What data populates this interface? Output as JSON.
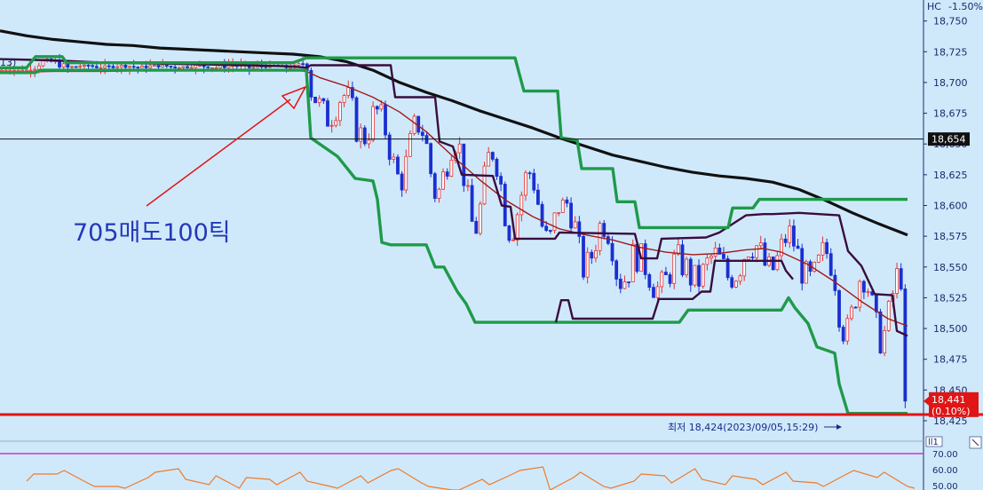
{
  "chart_data": {
    "type": "candlestick",
    "header": {
      "name": "HC",
      "change": "-1.50%"
    },
    "y_ticks": [
      18750,
      18725,
      18700,
      18675,
      18650,
      18625,
      18600,
      18575,
      18550,
      18525,
      18500,
      18475,
      18450,
      18425
    ],
    "ylim": [
      18412,
      18762
    ],
    "bar_count": 220,
    "current_price": {
      "value": 18441,
      "label": "18,441",
      "change_label": "(0.10%)"
    },
    "marked_price": {
      "value": 18654,
      "label": "18,654"
    },
    "low_line": {
      "value": 18430
    },
    "annotations": {
      "sell_note": "705매도100틱",
      "low_note": "최저 18,424(2023/09/05,15:29)",
      "top_left_fragment": "13)"
    },
    "lower_panel": {
      "y_ticks": [
        "70.00",
        "60.00",
        "50.00"
      ],
      "upper_band": 70,
      "corner_mark": "ll1"
    },
    "series": {
      "ma_long": [
        [
          0,
          18742
        ],
        [
          30,
          18738
        ],
        [
          60,
          18735
        ],
        [
          90,
          18733
        ],
        [
          120,
          18731
        ],
        [
          150,
          18730
        ],
        [
          180,
          18728
        ],
        [
          210,
          18727
        ],
        [
          240,
          18726
        ],
        [
          270,
          18725
        ],
        [
          300,
          18724
        ],
        [
          330,
          18723
        ],
        [
          360,
          18721
        ],
        [
          390,
          18717
        ],
        [
          420,
          18710
        ],
        [
          450,
          18700
        ],
        [
          480,
          18692
        ],
        [
          510,
          18685
        ],
        [
          540,
          18677
        ],
        [
          570,
          18670
        ],
        [
          600,
          18663
        ],
        [
          630,
          18655
        ],
        [
          660,
          18648
        ],
        [
          690,
          18641
        ],
        [
          720,
          18636
        ],
        [
          750,
          18631
        ],
        [
          780,
          18627
        ],
        [
          810,
          18624
        ],
        [
          840,
          18622
        ],
        [
          870,
          18619
        ],
        [
          900,
          18613
        ],
        [
          930,
          18604
        ],
        [
          960,
          18594
        ],
        [
          990,
          18585
        ],
        [
          1022,
          18576
        ]
      ],
      "ma_mid": [
        [
          0,
          18708
        ],
        [
          60,
          18709
        ],
        [
          120,
          18709
        ],
        [
          180,
          18710
        ],
        [
          240,
          18710
        ],
        [
          300,
          18710
        ],
        [
          330,
          18710
        ],
        [
          345,
          18709
        ],
        [
          360,
          18704
        ],
        [
          390,
          18697
        ],
        [
          420,
          18688
        ],
        [
          450,
          18676
        ],
        [
          480,
          18660
        ],
        [
          510,
          18640
        ],
        [
          540,
          18621
        ],
        [
          570,
          18604
        ],
        [
          600,
          18591
        ],
        [
          630,
          18581
        ],
        [
          660,
          18576
        ],
        [
          690,
          18572
        ],
        [
          720,
          18566
        ],
        [
          750,
          18562
        ],
        [
          780,
          18560
        ],
        [
          810,
          18561
        ],
        [
          840,
          18564
        ],
        [
          860,
          18565
        ],
        [
          880,
          18562
        ],
        [
          910,
          18552
        ],
        [
          940,
          18538
        ],
        [
          970,
          18522
        ],
        [
          1000,
          18508
        ],
        [
          1022,
          18502
        ]
      ],
      "ma_fast_purple": [
        [
          0,
          18719
        ],
        [
          60,
          18718
        ],
        [
          120,
          18716
        ],
        [
          200,
          18715
        ],
        [
          280,
          18714
        ],
        [
          330,
          18713
        ],
        [
          345,
          18712
        ],
        [
          350,
          18714
        ],
        [
          360,
          18714
        ],
        [
          440,
          18714
        ],
        [
          445,
          18688
        ],
        [
          490,
          18688
        ],
        [
          495,
          18652
        ],
        [
          510,
          18648
        ],
        [
          520,
          18625
        ],
        [
          555,
          18624
        ],
        [
          565,
          18600
        ],
        [
          575,
          18599
        ],
        [
          580,
          18573
        ],
        [
          625,
          18573
        ],
        [
          630,
          18578
        ],
        [
          715,
          18577
        ],
        [
          722,
          18557
        ],
        [
          740,
          18557
        ],
        [
          745,
          18573
        ],
        [
          795,
          18574
        ],
        [
          810,
          18578
        ],
        [
          840,
          18592
        ],
        [
          860,
          18593
        ],
        [
          870,
          18593
        ],
        [
          900,
          18594
        ],
        [
          945,
          18592
        ],
        [
          955,
          18563
        ],
        [
          970,
          18551
        ],
        [
          985,
          18528
        ],
        [
          1005,
          18527
        ],
        [
          1010,
          18498
        ],
        [
          1022,
          18494
        ]
      ],
      "band_upper": [
        [
          0,
          18712
        ],
        [
          30,
          18712
        ],
        [
          40,
          18721
        ],
        [
          70,
          18721
        ],
        [
          75,
          18716
        ],
        [
          280,
          18716
        ],
        [
          330,
          18716
        ],
        [
          345,
          18720
        ],
        [
          580,
          18720
        ],
        [
          590,
          18693
        ],
        [
          628,
          18693
        ],
        [
          632,
          18655
        ],
        [
          650,
          18653
        ],
        [
          655,
          18630
        ],
        [
          690,
          18630
        ],
        [
          695,
          18603
        ],
        [
          715,
          18603
        ],
        [
          720,
          18582
        ],
        [
          820,
          18582
        ],
        [
          825,
          18598
        ],
        [
          848,
          18598
        ],
        [
          855,
          18605
        ],
        [
          1022,
          18605
        ]
      ],
      "band_lower": [
        [
          0,
          18708
        ],
        [
          40,
          18708
        ],
        [
          45,
          18710
        ],
        [
          330,
          18710
        ],
        [
          345,
          18710
        ],
        [
          350,
          18655
        ],
        [
          380,
          18640
        ],
        [
          400,
          18622
        ],
        [
          420,
          18620
        ],
        [
          425,
          18605
        ],
        [
          430,
          18570
        ],
        [
          440,
          18568
        ],
        [
          480,
          18568
        ],
        [
          490,
          18550
        ],
        [
          500,
          18550
        ],
        [
          515,
          18530
        ],
        [
          525,
          18520
        ],
        [
          535,
          18505
        ],
        [
          765,
          18505
        ],
        [
          775,
          18515
        ],
        [
          880,
          18515
        ],
        [
          888,
          18525
        ],
        [
          895,
          18517
        ],
        [
          910,
          18504
        ],
        [
          920,
          18485
        ],
        [
          940,
          18480
        ],
        [
          945,
          18455
        ],
        [
          955,
          18431
        ],
        [
          1022,
          18431
        ]
      ],
      "band_inner": [
        [
          626,
          18505
        ],
        [
          632,
          18523
        ],
        [
          640,
          18523
        ],
        [
          645,
          18508
        ],
        [
          735,
          18508
        ],
        [
          742,
          18524
        ],
        [
          780,
          18524
        ],
        [
          790,
          18530
        ],
        [
          800,
          18530
        ],
        [
          805,
          18555
        ],
        [
          880,
          18555
        ],
        [
          885,
          18547
        ],
        [
          893,
          18540
        ]
      ],
      "rsi_values": [
        5,
        9,
        4,
        2,
        7,
        12,
        3,
        1,
        6,
        10,
        2,
        8,
        11,
        4,
        0,
        6,
        9,
        13,
        7,
        2,
        5,
        8,
        12,
        3,
        6,
        10,
        4,
        9,
        7,
        2
      ]
    }
  }
}
